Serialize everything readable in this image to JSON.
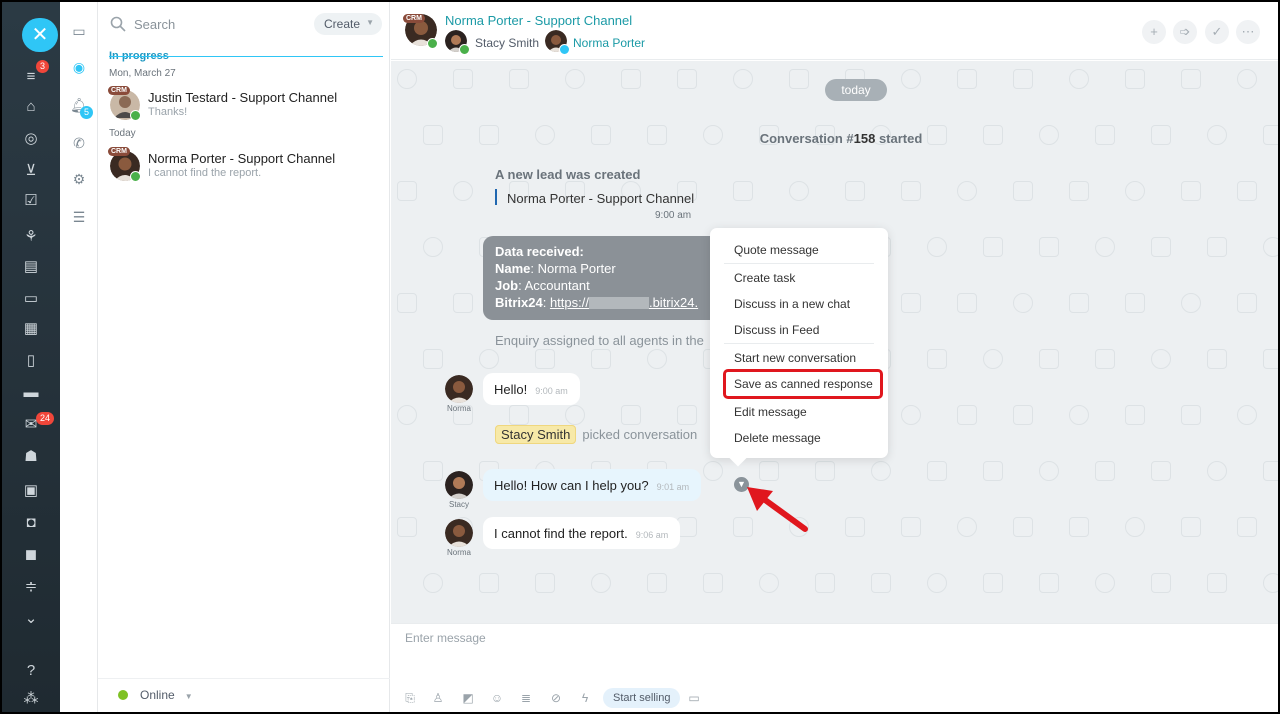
{
  "sidebar": {
    "close_icon": "close-icon",
    "badges": {
      "filter": "3",
      "mail": "24"
    }
  },
  "icon_column": {
    "badge": "5"
  },
  "recent": {
    "search_placeholder": "Search",
    "create_label": "Create",
    "section_label": "In progress",
    "date1": "Mon, March 27",
    "date2": "Today",
    "crm_badge": "CRM",
    "items": [
      {
        "name": "Justin Testard - Support Channel",
        "message": "Thanks!"
      },
      {
        "name": "Norma Porter - Support Channel",
        "message": "I cannot find the report."
      }
    ],
    "status": "Online"
  },
  "chat_header": {
    "title": "Norma Porter - Support Channel",
    "participant1": "Stacy Smith",
    "participant2": "Norma Porter"
  },
  "chat": {
    "date_pill": "today",
    "conv_prefix": "Conversation #",
    "conv_number": "158",
    "conv_suffix": " started",
    "lead_title": "A new lead was created",
    "lead_name": "Norma Porter - Support Channel",
    "lead_time": "9:00 am",
    "data": {
      "heading": "Data received:",
      "name_label": "Name",
      "name_value": ": Norma Porter",
      "job_label": "Job",
      "job_value": ": Accountant",
      "bitrix_label": "Bitrix24",
      "bitrix_value_prefix": "https://",
      "bitrix_value_suffix": ".bitrix24."
    },
    "enquiry": "Enquiry assigned to all agents in the",
    "messages": [
      {
        "author": "Norma",
        "text": "Hello!",
        "time": "9:00 am"
      },
      {
        "author": "Stacy",
        "text": "Hello! How can I help you?",
        "time": "9:01 am"
      },
      {
        "author": "Norma",
        "text": "I cannot find the report.",
        "time": "9:06 am"
      }
    ],
    "picked_name": "Stacy Smith",
    "picked_text": "picked conversation"
  },
  "context_menu": {
    "items": [
      "Quote message",
      "Create task",
      "Discuss in a new chat",
      "Discuss in Feed",
      "Start new conversation",
      "Save as canned response",
      "Edit message",
      "Delete message"
    ],
    "highlighted": "Save as canned response"
  },
  "input": {
    "placeholder": "Enter message",
    "start_selling": "Start selling"
  },
  "colors": {
    "accent": "#2fc6f6",
    "highlight": "#e0171e",
    "link": "#1b9aa6"
  }
}
